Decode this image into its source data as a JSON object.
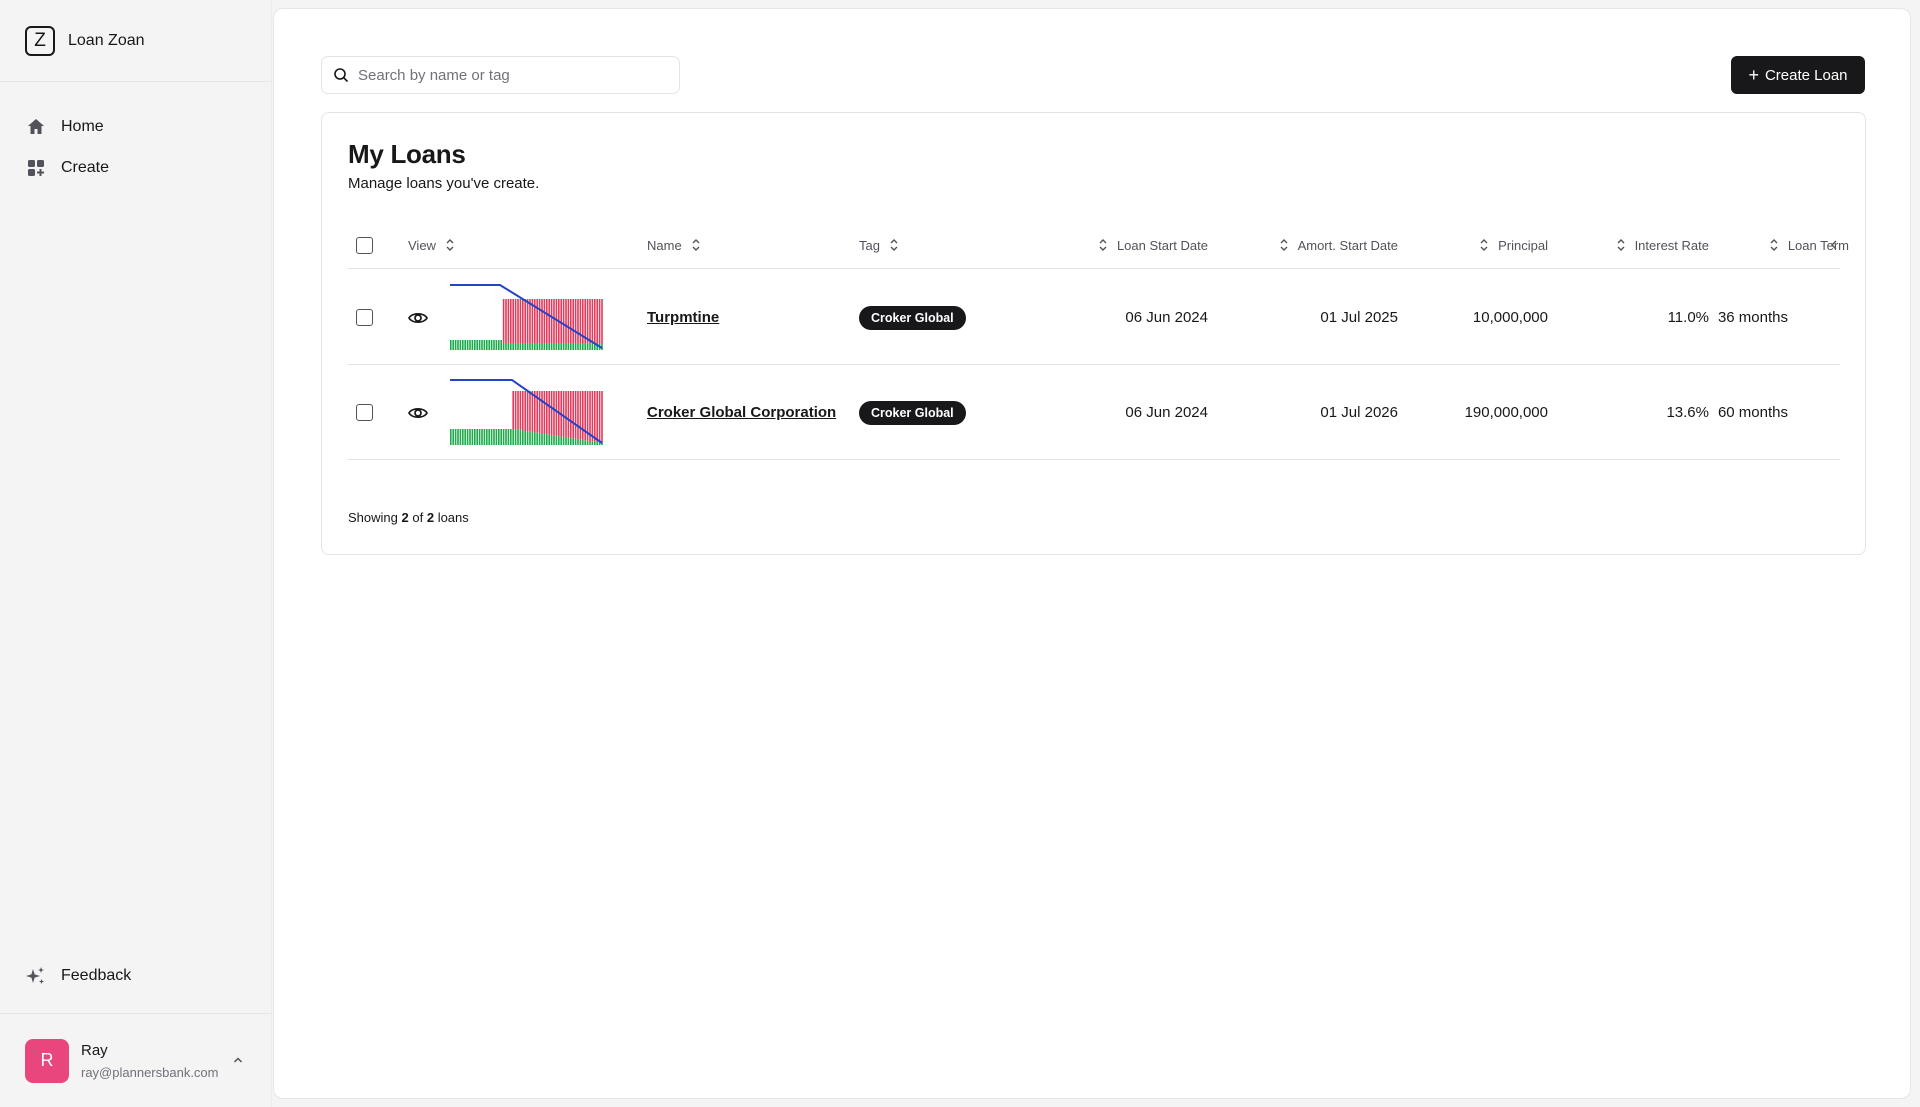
{
  "app": {
    "logo_letter": "Z",
    "name": "Loan Zoan"
  },
  "nav": {
    "home": "Home",
    "create": "Create",
    "feedback": "Feedback"
  },
  "user": {
    "initial": "R",
    "name": "Ray",
    "email": "ray@plannersbank.com"
  },
  "toolbar": {
    "search_placeholder": "Search by name or tag",
    "create_label": "Create Loan"
  },
  "card": {
    "title": "My Loans",
    "subtitle": "Manage loans you've create."
  },
  "table": {
    "headers": {
      "view": "View",
      "name": "Name",
      "tag": "Tag",
      "loan_start": "Loan Start Date",
      "amort_start": "Amort. Start Date",
      "principal": "Principal",
      "interest": "Interest Rate",
      "term": "Loan Term"
    },
    "rows": [
      {
        "name": "Turpmtine",
        "tag": "Croker Global",
        "loan_start": "06 Jun 2024",
        "amort_start": "01 Jul 2025",
        "principal": "10,000,000",
        "interest": "11.0%",
        "term": "36 months"
      },
      {
        "name": "Croker Global Corporation",
        "tag": "Croker Global",
        "loan_start": "06 Jun 2024",
        "amort_start": "01 Jul 2026",
        "principal": "190,000,000",
        "interest": "13.6%",
        "term": "60 months"
      }
    ]
  },
  "footer": {
    "prefix": "Showing",
    "shown": "2",
    "of": "of",
    "total": "2",
    "suffix": "loans"
  },
  "colors": {
    "accent": "#18181b",
    "avatar": "#e8467c",
    "bar_red": "#e23a5c",
    "bar_green": "#1fa94a",
    "line_blue": "#2443c6"
  }
}
